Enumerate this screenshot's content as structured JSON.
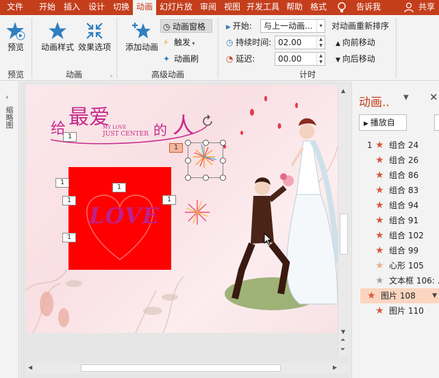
{
  "tabs": [
    {
      "label": "文件"
    },
    {
      "label": "开始"
    },
    {
      "label": "插入"
    },
    {
      "label": "设计"
    },
    {
      "label": "切换"
    },
    {
      "label": "动画"
    },
    {
      "label": "幻灯片放"
    },
    {
      "label": "审阅"
    },
    {
      "label": "视图"
    },
    {
      "label": "开发工具"
    },
    {
      "label": "帮助"
    },
    {
      "label": "格式"
    }
  ],
  "tell_me": "告诉我",
  "share": "共享",
  "ribbon": {
    "preview": "预览",
    "preview_group": "预览",
    "anim_style": "动画样式",
    "effect_options": "效果选项",
    "anim_group": "动画",
    "add_anim": "添加动画",
    "anim_pane": "动画窗格",
    "trigger": "触发",
    "anim_painter": "动画刷",
    "adv_group": "高级动画",
    "start_label": "开始:",
    "start_value": "与上一动画...",
    "duration_label": "持续时间:",
    "duration_value": "02.00",
    "delay_label": "延迟:",
    "delay_value": "00.00",
    "timing_group": "计时",
    "reorder": "对动画重新排序",
    "move_earlier": "向前移动",
    "move_later": "向后移动"
  },
  "left_pane_label": "缩略图",
  "slide": {
    "title_main": "最爱",
    "title_pre": "给",
    "title_post": "人",
    "title_de": "的",
    "title_sub1": "MY LOVE",
    "title_sub2": "JUST CENTER",
    "love_text": "LOVE",
    "tags": [
      "1",
      "1",
      "1",
      "1",
      "1",
      "1",
      "1"
    ]
  },
  "animpane": {
    "title": "动画..",
    "play_from": "播放自",
    "items": [
      {
        "num": "1",
        "label": "组合 24",
        "star": "#d9573b"
      },
      {
        "num": "",
        "label": "组合 26",
        "star": "#d9573b"
      },
      {
        "num": "",
        "label": "组合 86",
        "star": "#d9573b"
      },
      {
        "num": "",
        "label": "组合 83",
        "star": "#d9573b"
      },
      {
        "num": "",
        "label": "组合 94",
        "star": "#d9573b"
      },
      {
        "num": "",
        "label": "组合 91",
        "star": "#d9573b"
      },
      {
        "num": "",
        "label": "组合 102",
        "star": "#d9573b"
      },
      {
        "num": "",
        "label": "组合 99",
        "star": "#d9573b"
      },
      {
        "num": "",
        "label": "心形 105",
        "star": "#e8b08f"
      },
      {
        "num": "",
        "label": "文本框 106: ..",
        "star": "#9aa6ad"
      },
      {
        "num": "",
        "label": "图片 108",
        "star": "#d9573b"
      },
      {
        "num": "",
        "label": "图片 110",
        "star": "#d9573b"
      }
    ]
  },
  "colors": {
    "accent": "#c43e1c",
    "love_box": "#ff0000",
    "love_text": "#c0208a"
  }
}
